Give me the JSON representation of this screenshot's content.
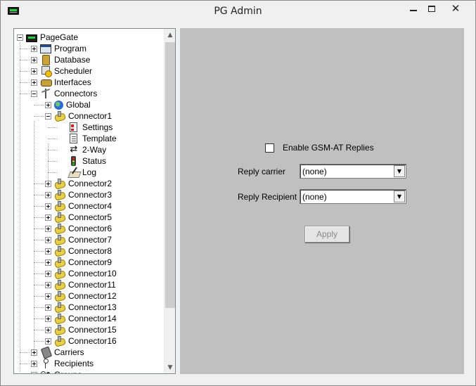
{
  "window": {
    "title": "PG Admin",
    "close_glyph": "✕"
  },
  "tree": {
    "items": [
      {
        "label": "PageGate",
        "icon": "pagegate-icon",
        "expander": "minus"
      },
      {
        "label": "Program",
        "icon": "program-icon",
        "expander": "plus"
      },
      {
        "label": "Database",
        "icon": "database-icon",
        "expander": "plus"
      },
      {
        "label": "Scheduler",
        "icon": "scheduler-icon",
        "expander": "plus"
      },
      {
        "label": "Interfaces",
        "icon": "interfaces-icon",
        "expander": "plus"
      },
      {
        "label": "Connectors",
        "icon": "connectors-icon",
        "expander": "minus"
      },
      {
        "label": "Global",
        "icon": "globe-icon",
        "expander": "plus"
      },
      {
        "label": "Connector1",
        "icon": "connector-icon",
        "expander": "minus"
      },
      {
        "label": "Settings",
        "icon": "settings-icon",
        "expander": "none"
      },
      {
        "label": "Template",
        "icon": "template-icon",
        "expander": "none"
      },
      {
        "label": "2-Way",
        "icon": "two-way-arrows-icon",
        "expander": "none"
      },
      {
        "label": "Status",
        "icon": "status-light-icon",
        "expander": "none"
      },
      {
        "label": "Log",
        "icon": "log-icon",
        "expander": "none"
      },
      {
        "label": "Connector2",
        "icon": "connector-icon",
        "expander": "plus"
      },
      {
        "label": "Connector3",
        "icon": "connector-icon",
        "expander": "plus"
      },
      {
        "label": "Connector4",
        "icon": "connector-icon",
        "expander": "plus"
      },
      {
        "label": "Connector5",
        "icon": "connector-icon",
        "expander": "plus"
      },
      {
        "label": "Connector6",
        "icon": "connector-icon",
        "expander": "plus"
      },
      {
        "label": "Connector7",
        "icon": "connector-icon",
        "expander": "plus"
      },
      {
        "label": "Connector8",
        "icon": "connector-icon",
        "expander": "plus"
      },
      {
        "label": "Connector9",
        "icon": "connector-icon",
        "expander": "plus"
      },
      {
        "label": "Connector10",
        "icon": "connector-icon",
        "expander": "plus"
      },
      {
        "label": "Connector11",
        "icon": "connector-icon",
        "expander": "plus"
      },
      {
        "label": "Connector12",
        "icon": "connector-icon",
        "expander": "plus"
      },
      {
        "label": "Connector13",
        "icon": "connector-icon",
        "expander": "plus"
      },
      {
        "label": "Connector14",
        "icon": "connector-icon",
        "expander": "plus"
      },
      {
        "label": "Connector15",
        "icon": "connector-icon",
        "expander": "plus"
      },
      {
        "label": "Connector16",
        "icon": "connector-icon",
        "expander": "plus"
      },
      {
        "label": "Carriers",
        "icon": "carriers-icon",
        "expander": "plus"
      },
      {
        "label": "Recipients",
        "icon": "recipients-icon",
        "expander": "plus"
      },
      {
        "label": "Groups",
        "icon": "groups-icon",
        "expander": "plus"
      }
    ]
  },
  "panel": {
    "enable_gsm_label": "Enable GSM-AT Replies",
    "enable_gsm_checked": false,
    "reply_carrier_label": "Reply carrier",
    "reply_carrier_value": "(none)",
    "reply_recipient_label": "Reply Recipient",
    "reply_recipient_value": "(none)",
    "apply_label": "Apply"
  },
  "colors": {
    "panel_bg": "#c0c0c0",
    "window_bg": "#f0f0f0"
  }
}
